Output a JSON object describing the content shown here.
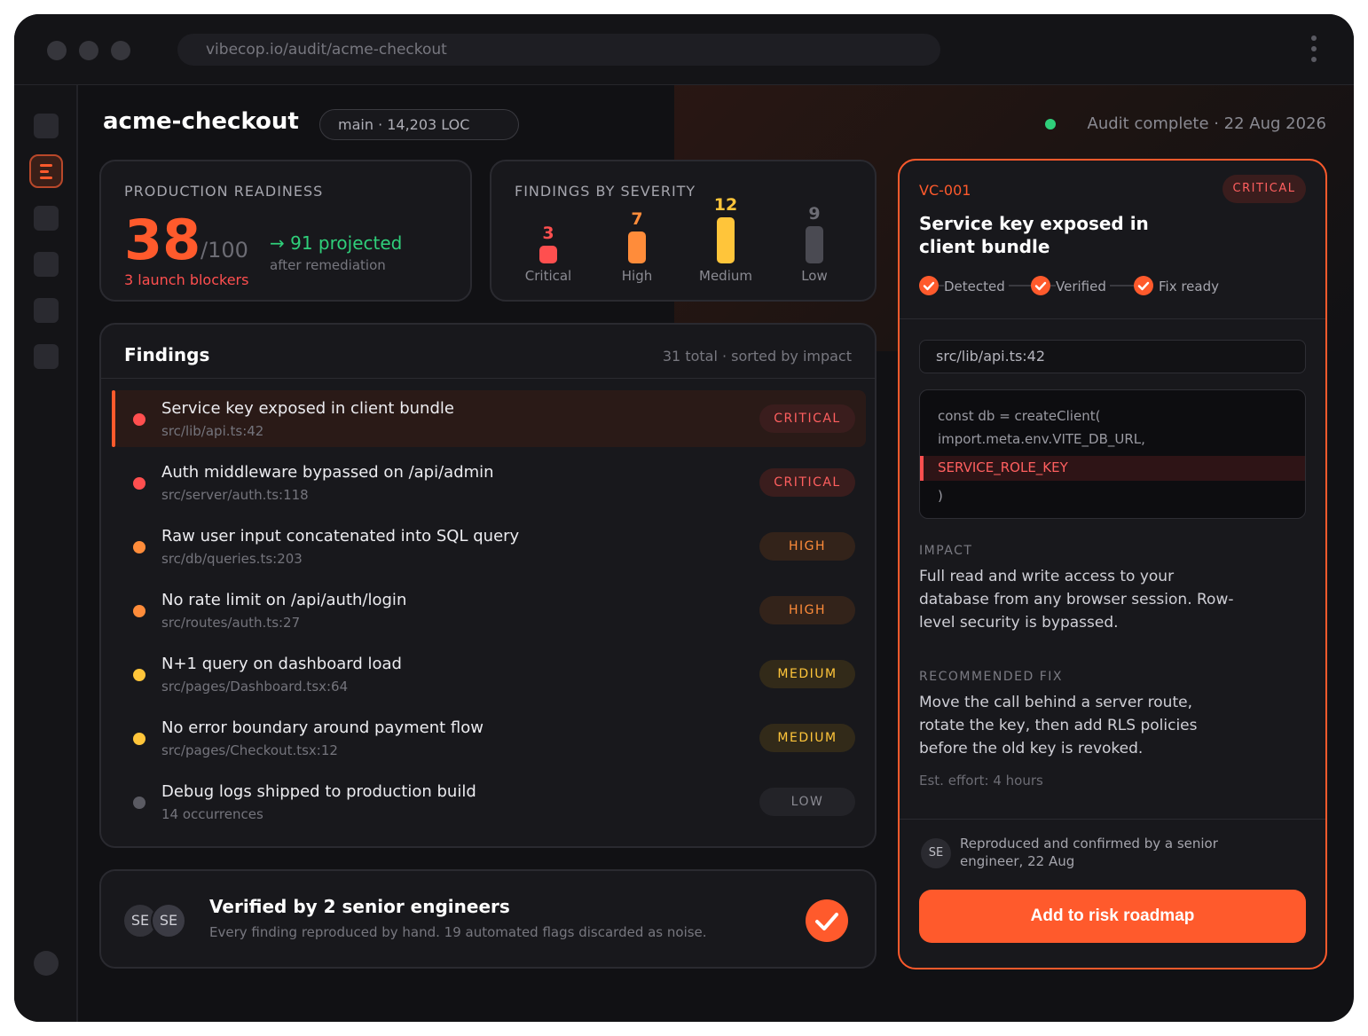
{
  "browser": {
    "url": "vibecop.io/audit/acme-checkout"
  },
  "header": {
    "project": "acme-checkout",
    "branch": "main · 14,203 LOC",
    "status": "Audit complete · 22 Aug 2026",
    "status_color": "#2fcf7a"
  },
  "readiness": {
    "label": "PRODUCTION READINESS",
    "score": "38",
    "score_of": "/100",
    "score_fraction": 0.38,
    "blockers": "3 launch blockers",
    "projected": "→ 91 projected",
    "projected_sub": "after remediation"
  },
  "severity": {
    "label": "FINDINGS BY SEVERITY",
    "items": [
      {
        "name": "Critical",
        "count": "3",
        "color": "#ff4f4f"
      },
      {
        "name": "High",
        "count": "7",
        "color": "#ff8c3a"
      },
      {
        "name": "Medium",
        "count": "12",
        "color": "#ffc53a"
      },
      {
        "name": "Low",
        "count": "9",
        "color": "#5a5a62"
      }
    ]
  },
  "findings": {
    "title": "Findings",
    "meta": "31 total · sorted by impact",
    "rows": [
      {
        "title": "Service key exposed in client bundle",
        "path": "src/lib/api.ts:42",
        "severity": "CRITICAL",
        "dot": "#ff4f4f",
        "selected": true
      },
      {
        "title": "Auth middleware bypassed on /api/admin",
        "path": "src/server/auth.ts:118",
        "severity": "CRITICAL",
        "dot": "#ff4f4f"
      },
      {
        "title": "Raw user input concatenated into SQL query",
        "path": "src/db/queries.ts:203",
        "severity": "HIGH",
        "dot": "#ff8c3a"
      },
      {
        "title": "No rate limit on /api/auth/login",
        "path": "src/routes/auth.ts:27",
        "severity": "HIGH",
        "dot": "#ff8c3a"
      },
      {
        "title": "N+1 query on dashboard load",
        "path": "src/pages/Dashboard.tsx:64",
        "severity": "MEDIUM",
        "dot": "#ffc53a"
      },
      {
        "title": "No error boundary around payment flow",
        "path": "src/pages/Checkout.tsx:12",
        "severity": "MEDIUM",
        "dot": "#ffc53a"
      },
      {
        "title": "Debug logs shipped to production build",
        "path": "14 occurrences",
        "severity": "LOW",
        "dot": "#5a5a62"
      }
    ]
  },
  "verified": {
    "avatars": [
      "SE",
      "SE"
    ],
    "title": "Verified by 2 senior engineers",
    "subtitle": "Every finding reproduced by hand. 19 automated flags discarded as noise."
  },
  "detail": {
    "id": "VC-001",
    "severity": "CRITICAL",
    "title": "Service key exposed in client bundle",
    "steps": [
      "Detected",
      "Verified",
      "Fix ready"
    ],
    "path": "src/lib/api.ts:42",
    "code": [
      "const db = createClient(",
      "import.meta.env.VITE_DB_URL,",
      "SERVICE_ROLE_KEY",
      ")"
    ],
    "impact_label": "IMPACT",
    "impact": "Full read and write access to your database from any browser session. Row-level security is bypassed.",
    "fix_label": "RECOMMENDED FIX",
    "fix": "Move the call behind a server route, rotate the key, then add RLS policies before the old key is revoked.",
    "effort": "Est. effort: 4 hours",
    "confirm_avatar": "SE",
    "confirm": "Reproduced and confirmed by a senior engineer, 22 Aug",
    "cta": "Add to risk roadmap"
  },
  "colors": {
    "accent": "#ff5a2c",
    "critical": "#ff4f4f",
    "high": "#ff8c3a",
    "medium": "#ffc53a",
    "success": "#2fcf7a"
  }
}
